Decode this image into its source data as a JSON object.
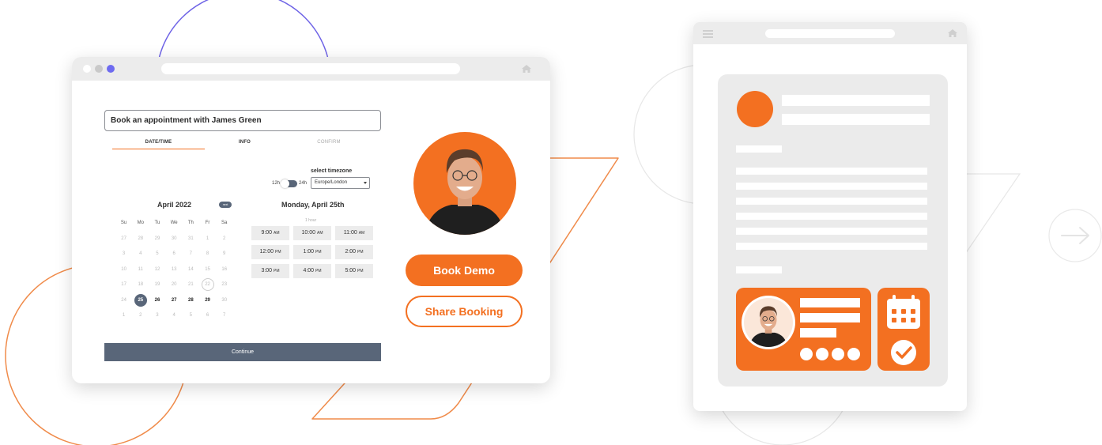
{
  "colors": {
    "accent": "#f37021",
    "primary_dark": "#596679",
    "chrome": "#ececec",
    "decor_purple": "#6e63e6",
    "dot_purple": "#6e6bf0"
  },
  "icons": {
    "home": "home-icon",
    "menu": "hamburger-menu-icon",
    "calendar": "calendar-icon",
    "check": "check-circle-icon",
    "arrow": "arrow-right-icon"
  },
  "booking": {
    "title": "Book an appointment with James Green",
    "steps": [
      "DATE/TIME",
      "INFO",
      "CONFIRM"
    ],
    "active_step": 0,
    "timezone": {
      "label": "select timezone",
      "format_12": "12h",
      "format_24": "24h",
      "selected": "Europe/London"
    },
    "calendar": {
      "month": "April 2022",
      "next_label": "next",
      "weekdays": [
        "Su",
        "Mo",
        "Tu",
        "We",
        "Th",
        "Fr",
        "Sa"
      ],
      "days": [
        {
          "d": "27",
          "s": "muted"
        },
        {
          "d": "28",
          "s": "muted"
        },
        {
          "d": "29",
          "s": "muted"
        },
        {
          "d": "30",
          "s": "muted"
        },
        {
          "d": "31",
          "s": "muted"
        },
        {
          "d": "1",
          "s": "muted"
        },
        {
          "d": "2",
          "s": "muted"
        },
        {
          "d": "3",
          "s": "muted"
        },
        {
          "d": "4",
          "s": "muted"
        },
        {
          "d": "5",
          "s": "muted"
        },
        {
          "d": "6",
          "s": "muted"
        },
        {
          "d": "7",
          "s": "muted"
        },
        {
          "d": "8",
          "s": "muted"
        },
        {
          "d": "9",
          "s": "muted"
        },
        {
          "d": "10",
          "s": "muted"
        },
        {
          "d": "11",
          "s": "muted"
        },
        {
          "d": "12",
          "s": "muted"
        },
        {
          "d": "13",
          "s": "muted"
        },
        {
          "d": "14",
          "s": "muted"
        },
        {
          "d": "15",
          "s": "muted"
        },
        {
          "d": "16",
          "s": "muted"
        },
        {
          "d": "17",
          "s": "muted"
        },
        {
          "d": "18",
          "s": "muted"
        },
        {
          "d": "19",
          "s": "muted"
        },
        {
          "d": "20",
          "s": "muted"
        },
        {
          "d": "21",
          "s": "muted"
        },
        {
          "d": "22",
          "s": "ringed"
        },
        {
          "d": "23",
          "s": "muted"
        },
        {
          "d": "24",
          "s": "muted"
        },
        {
          "d": "25",
          "s": "selected"
        },
        {
          "d": "26",
          "s": "avail"
        },
        {
          "d": "27",
          "s": "avail"
        },
        {
          "d": "28",
          "s": "avail"
        },
        {
          "d": "29",
          "s": "avail"
        },
        {
          "d": "30",
          "s": "muted"
        },
        {
          "d": "1",
          "s": "muted"
        },
        {
          "d": "2",
          "s": "muted"
        },
        {
          "d": "3",
          "s": "muted"
        },
        {
          "d": "4",
          "s": "muted"
        },
        {
          "d": "5",
          "s": "muted"
        },
        {
          "d": "6",
          "s": "muted"
        },
        {
          "d": "7",
          "s": "muted"
        }
      ]
    },
    "day_title": "Monday, April 25th",
    "duration": "1 hour",
    "slots": [
      "9:00 AM",
      "10:00 AM",
      "11:00 AM",
      "12:00 PM",
      "1:00 PM",
      "2:00 PM",
      "3:00 PM",
      "4:00 PM",
      "5:00 PM"
    ],
    "continue_label": "Continue",
    "book_demo_label": "Book Demo",
    "share_booking_label": "Share Booking"
  }
}
